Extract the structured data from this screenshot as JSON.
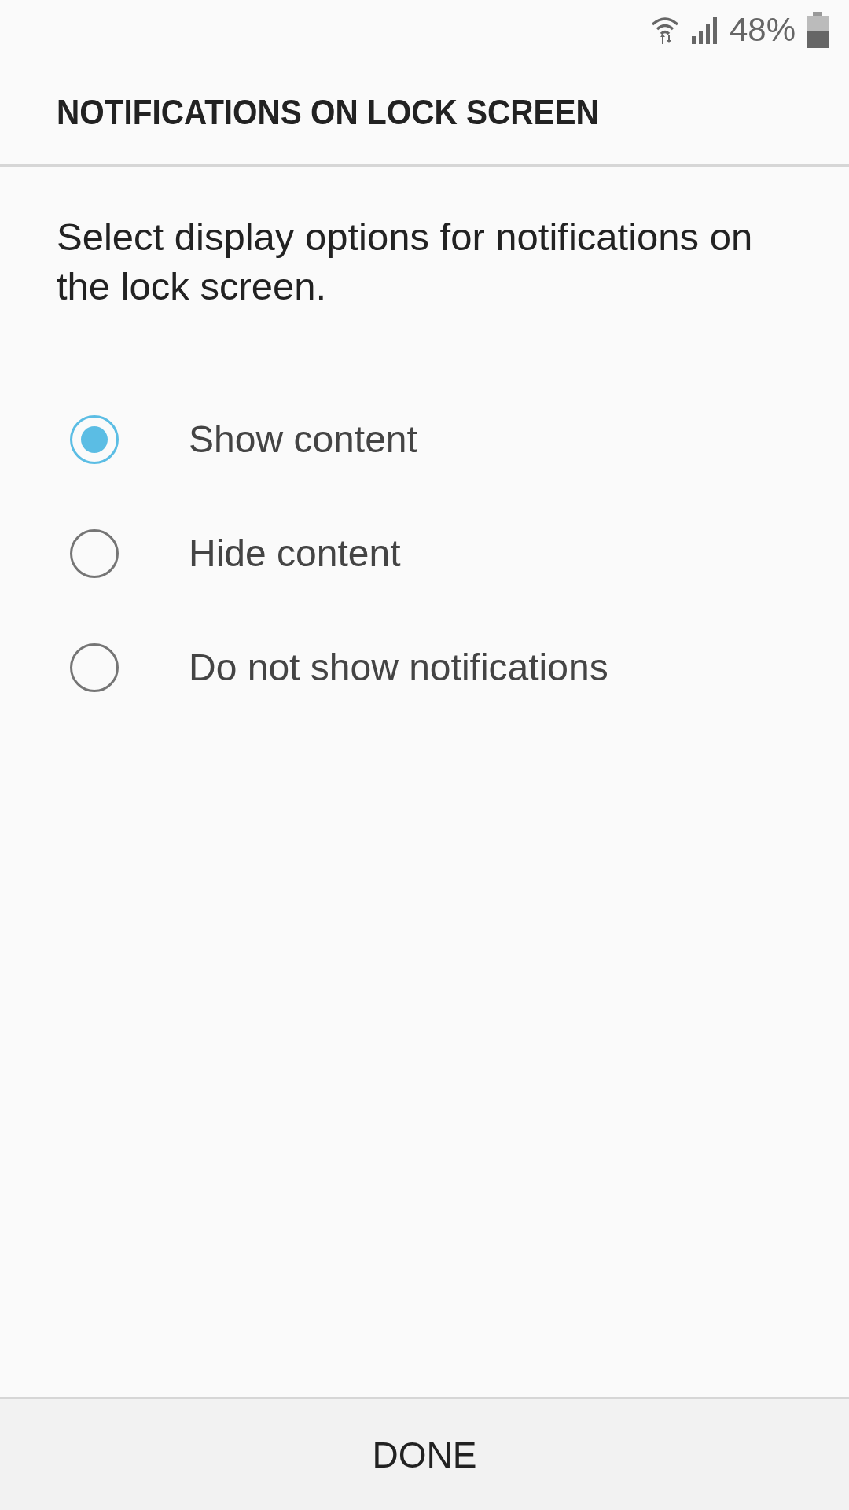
{
  "status_bar": {
    "battery_text": "48%"
  },
  "title": "NOTIFICATIONS ON LOCK SCREEN",
  "description": "Select display options for notifications on the lock screen.",
  "options": [
    {
      "label": "Show content",
      "selected": true
    },
    {
      "label": "Hide content",
      "selected": false
    },
    {
      "label": "Do not show notifications",
      "selected": false
    }
  ],
  "done_button": "DONE"
}
